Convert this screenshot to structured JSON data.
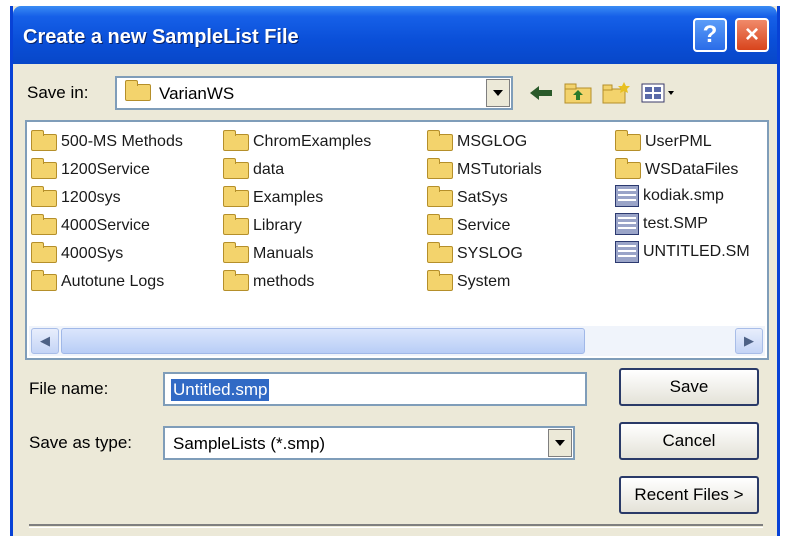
{
  "dialog": {
    "title": "Create a new SampleList File",
    "help_label": "?",
    "close_label": "×"
  },
  "toolbar": {
    "save_in_label": "Save in:",
    "save_in_value": "VarianWS",
    "icons": [
      "back-arrow-icon",
      "up-one-level-icon",
      "new-folder-icon",
      "view-menu-icon"
    ]
  },
  "files": {
    "col1": [
      "500-MS Methods",
      "1200Service",
      "1200sys",
      "4000Service",
      "4000Sys",
      "Autotune Logs"
    ],
    "col2": [
      "ChromExamples",
      "data",
      "Examples",
      "Library",
      "Manuals",
      "methods"
    ],
    "col3": [
      "MSGLOG",
      "MSTutorials",
      "SatSys",
      "Service",
      "SYSLOG",
      "System"
    ],
    "col4": [
      {
        "name": "UserPML",
        "type": "folder"
      },
      {
        "name": "WSDataFiles",
        "type": "folder"
      },
      {
        "name": "kodiak.smp",
        "type": "file"
      },
      {
        "name": "test.SMP",
        "type": "file"
      },
      {
        "name": "UNTITLED.SM",
        "type": "file"
      }
    ]
  },
  "form": {
    "file_name_label": "File name:",
    "file_name_value": "Untitled.smp",
    "save_as_type_label": "Save as type:",
    "save_as_type_value": "SampleLists (*.smp)"
  },
  "buttons": {
    "save": "Save",
    "cancel": "Cancel",
    "recent": "Recent Files >"
  },
  "colors": {
    "title_bar": "#0a4fd8",
    "dialog_bg": "#ece9d8",
    "selection": "#316ac5"
  }
}
